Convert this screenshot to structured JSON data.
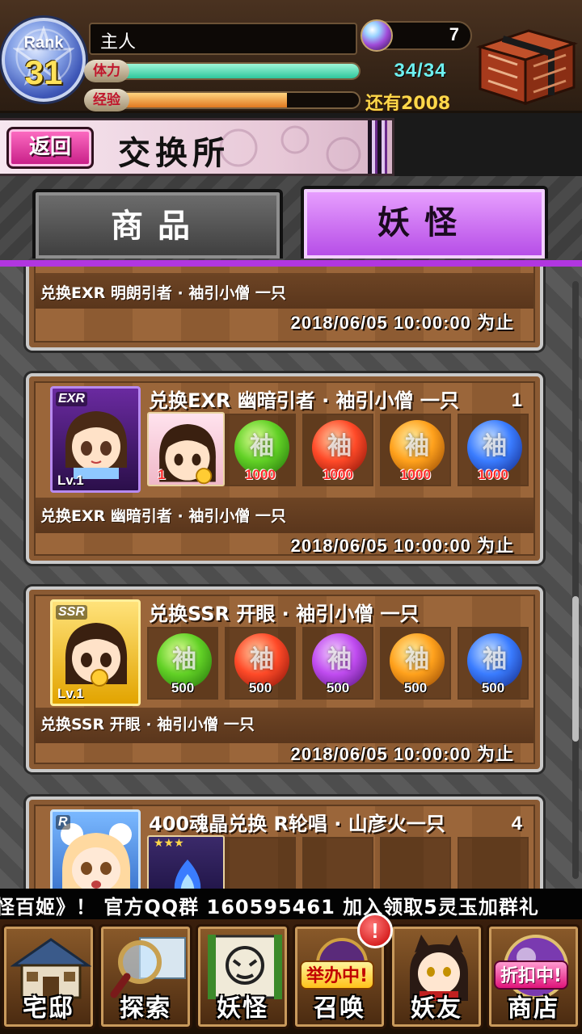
{
  "header": {
    "rank_label": "Rank",
    "rank_value": "31",
    "player_name": "主人",
    "stamina_label": "体力",
    "stamina_value": "34/34",
    "stamina_fraction": 1.0,
    "exp_label": "经验",
    "exp_fraction": 0.7,
    "exp_remaining": "还有2008",
    "gem_count": "7"
  },
  "titlebar": {
    "back_label": "返回",
    "title": "交换所"
  },
  "tabs": {
    "goods": "商品",
    "yokai": "妖怪",
    "active": "yokai"
  },
  "items": [
    {
      "description": "兑换EXR 明朗引者 · 袖引小僧 一只",
      "deadline": "2018/06/05 10:00:00 为止"
    },
    {
      "title": "兑换EXR 幽暗引者 · 袖引小僧 一只",
      "count": "1",
      "rarity": "EXR",
      "level": "Lv.1",
      "slot_char_cost": "1",
      "orbs": [
        {
          "glyph": "袖",
          "color": "green",
          "cost": "1000"
        },
        {
          "glyph": "袖",
          "color": "red",
          "cost": "1000"
        },
        {
          "glyph": "袖",
          "color": "orange",
          "cost": "1000"
        },
        {
          "glyph": "袖",
          "color": "blue",
          "cost": "1000"
        }
      ],
      "description": "兑换EXR 幽暗引者 · 袖引小僧 一只",
      "deadline": "2018/06/05 10:00:00 为止"
    },
    {
      "title": "兑换SSR 开眼 · 袖引小僧 一只",
      "rarity": "SSR",
      "level": "Lv.1",
      "orbs": [
        {
          "glyph": "袖",
          "color": "green",
          "cost": "500"
        },
        {
          "glyph": "袖",
          "color": "red",
          "cost": "500"
        },
        {
          "glyph": "袖",
          "color": "purple",
          "cost": "500"
        },
        {
          "glyph": "袖",
          "color": "orange",
          "cost": "500"
        },
        {
          "glyph": "袖",
          "color": "blue",
          "cost": "500"
        }
      ],
      "description": "兑换SSR 开眼 · 袖引小僧 一只",
      "deadline": "2018/06/05 10:00:00 为止"
    },
    {
      "title": "400魂晶兑换 R轮唱 · 山彦火一只",
      "count": "4",
      "rarity": "R",
      "stars": "★★★"
    }
  ],
  "marquee": "怪百姬》！ 官方QQ群 160595461     加入领取5灵玉加群礼",
  "nav": {
    "home": "宅邸",
    "explore": "探索",
    "yokai": "妖怪",
    "summon": "召唤",
    "summon_promo": "举办中!",
    "friends": "妖友",
    "shop": "商店",
    "shop_promo": "折扣中!",
    "alert": "!"
  },
  "colors": {
    "tab_active": "#b44ae6",
    "stamina_bar": "#2ec79c",
    "exp_bar": "#e07820",
    "cost_red": "#ff2a2a"
  }
}
